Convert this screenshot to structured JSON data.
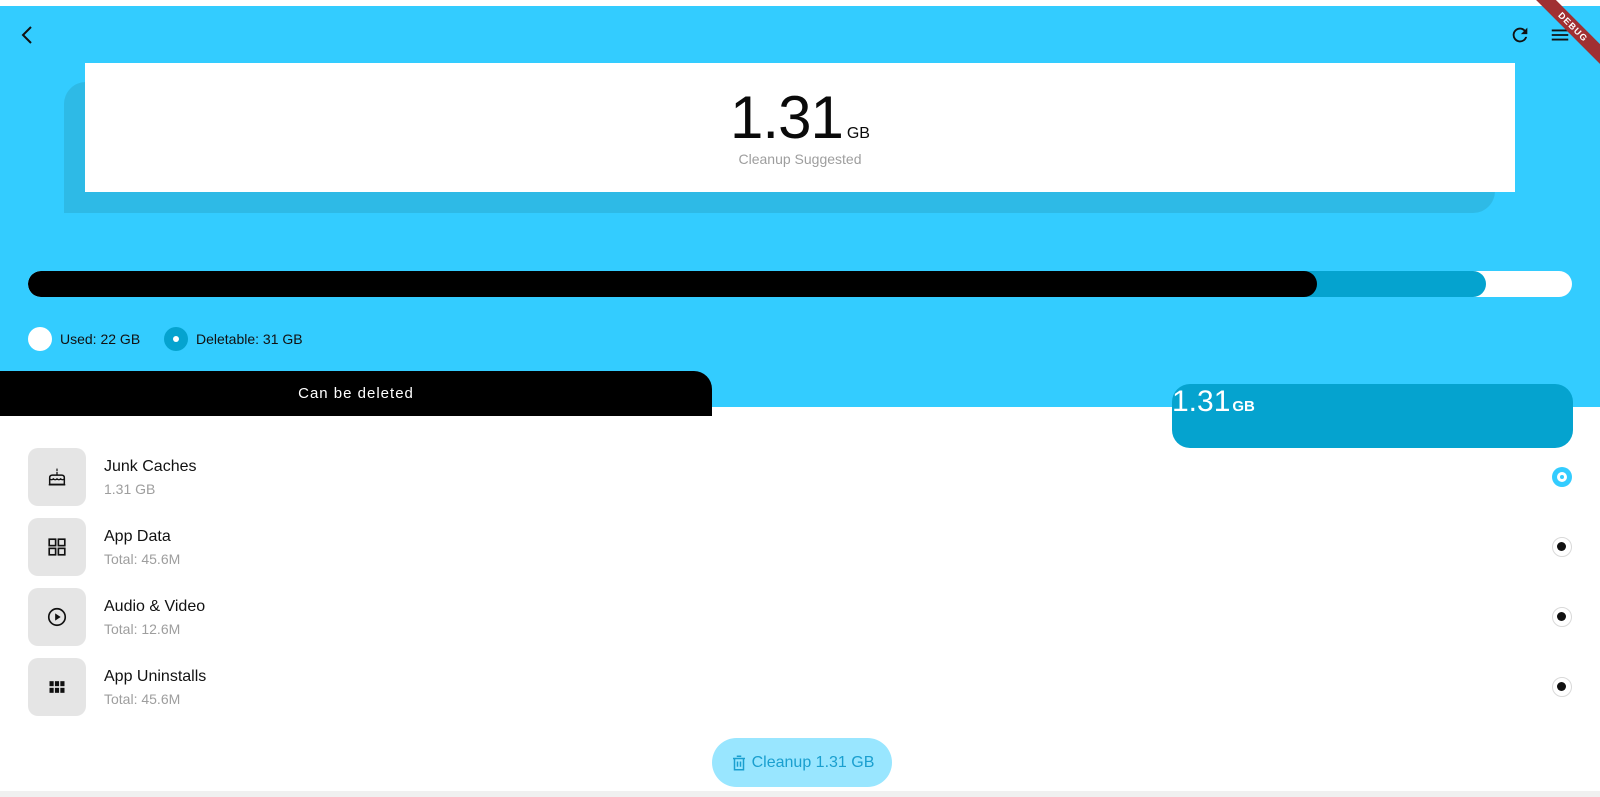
{
  "summary": {
    "value": "1.31",
    "unit": "GB",
    "subtitle": "Cleanup Suggested"
  },
  "storage": {
    "used_fraction": 0.835,
    "deletable_fraction": 0.944
  },
  "legend": {
    "used_label": "Used: 22 GB",
    "deletable_label": "Deletable: 31 GB"
  },
  "tab": {
    "label": "Can be deleted"
  },
  "pill": {
    "value": "1.31",
    "unit": "GB"
  },
  "items": [
    {
      "title": "Junk Caches",
      "subtitle": "1.31 GB",
      "icon": "cake-icon",
      "selected": true
    },
    {
      "title": "App Data",
      "subtitle": "Total: 45.6M",
      "icon": "grid-icon",
      "selected": false
    },
    {
      "title": "Audio & Video",
      "subtitle": "Total: 12.6M",
      "icon": "play-circle-icon",
      "selected": false
    },
    {
      "title": "App Uninstalls",
      "subtitle": "Total: 45.6M",
      "icon": "apps-icon",
      "selected": false
    }
  ],
  "cleanup_button": {
    "label": "Cleanup 1.31 GB"
  },
  "debug_banner": "DEBUG",
  "colors": {
    "primary": "#33ccff",
    "deep_blue": "#05a3cf",
    "button_bg": "#99e6ff"
  }
}
